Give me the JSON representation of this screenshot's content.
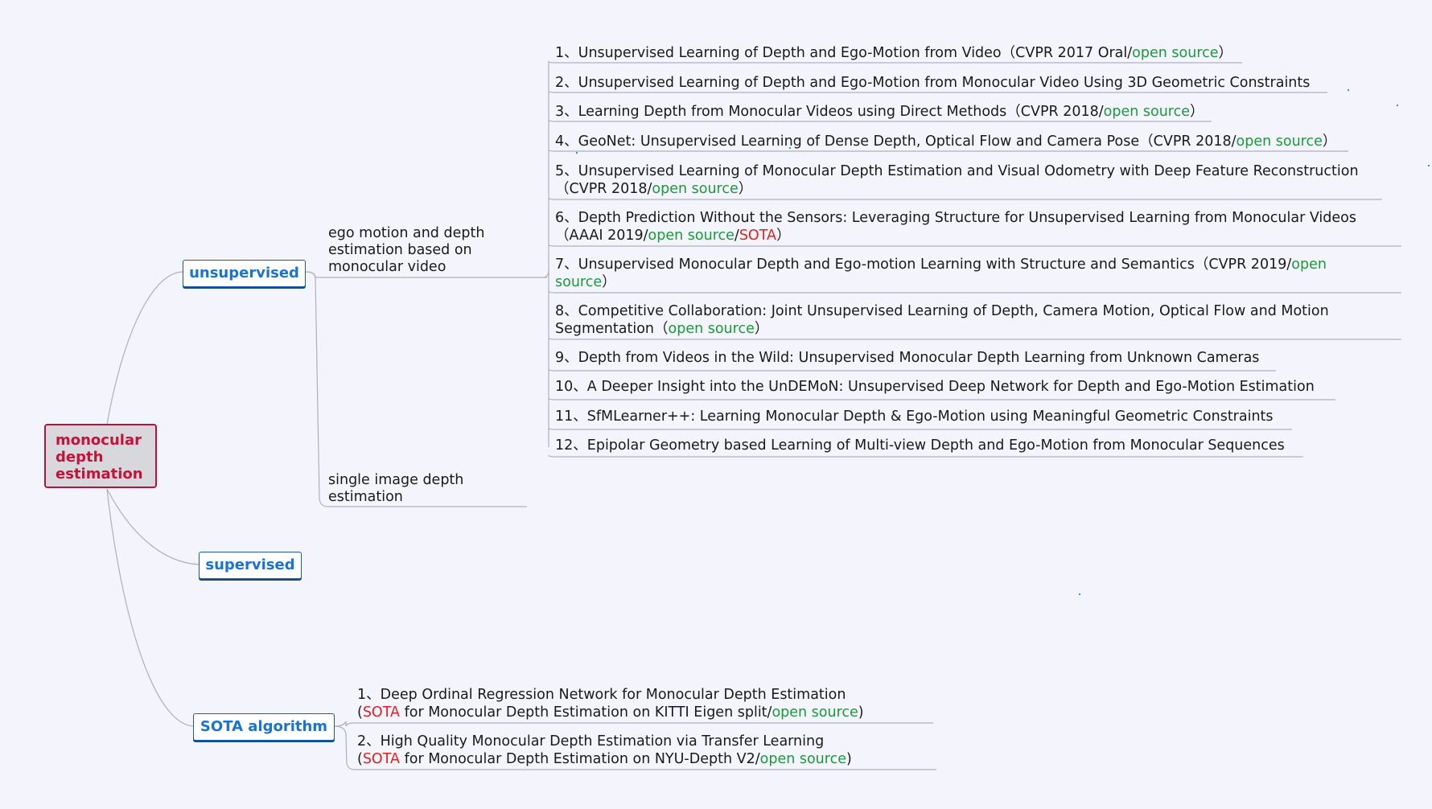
{
  "root": {
    "label": "monocular depth estimation"
  },
  "branches": {
    "unsupervised": {
      "label": "unsupervised",
      "subtopics": {
        "ego": {
          "label": "ego motion and depth estimation based on monocular video"
        },
        "single": {
          "label": "single image depth estimation"
        }
      },
      "papers": [
        {
          "num": "1、",
          "title": "Unsupervised Learning of Depth and Ego-Motion from Video",
          "venue": "（CVPR 2017 Oral/",
          "open": "open source",
          "close": "）"
        },
        {
          "num": "2、",
          "title": "Unsupervised Learning of Depth and Ego-Motion from Monocular Video Using 3D Geometric Constraints"
        },
        {
          "num": "3、",
          "title": "Learning Depth from Monocular Videos using Direct Methods",
          "venue": "（CVPR 2018/",
          "open": "open source",
          "close": "）"
        },
        {
          "num": "4、",
          "title": "GeoNet: Unsupervised Learning of Dense Depth, Optical Flow and Camera Pose",
          "venue": "（CVPR 2018/",
          "open": "open source",
          "close": "）"
        },
        {
          "num": "5、",
          "title": "Unsupervised Learning of Monocular Depth Estimation and Visual Odometry with Deep Feature Reconstruction",
          "venue": "（CVPR 2018/",
          "open": "open source",
          "close": "）"
        },
        {
          "num": "6、",
          "title": "Depth Prediction Without the Sensors: Leveraging Structure for Unsupervised Learning from Monocular Videos",
          "venue": "（AAAI 2019/",
          "open": "open source",
          "sep": "/",
          "sota": "SOTA",
          "close": "）"
        },
        {
          "num": "7、",
          "title": "Unsupervised Monocular Depth and Ego-motion Learning with Structure and Semantics",
          "venue": "（CVPR 2019/",
          "open1": "open",
          "open2": "source",
          "close": "）"
        },
        {
          "num": "8、",
          "title1": "Competitive Collaboration: Joint Unsupervised Learning of Depth, Camera Motion, Optical Flow and Motion",
          "title2": "Segmentation",
          "venue": "（",
          "open": "open source",
          "close": "）"
        },
        {
          "num": "9、",
          "title": "Depth from Videos in the Wild: Unsupervised Monocular Depth Learning from Unknown Cameras"
        },
        {
          "num": "10、",
          "title": "A Deeper Insight into the UnDEMoN: Unsupervised Deep Network for Depth and Ego-Motion Estimation"
        },
        {
          "num": "11、",
          "title": "SfMLearner++: Learning Monocular Depth & Ego-Motion using Meaningful Geometric Constraints"
        },
        {
          "num": "12、",
          "title": "Epipolar Geometry based Learning of Multi-view Depth and Ego-Motion from Monocular Sequences"
        }
      ]
    },
    "supervised": {
      "label": "supervised"
    },
    "sota": {
      "label": "SOTA algorithm",
      "papers": [
        {
          "num": "1、",
          "title": "Deep Ordinal Regression Network for Monocular Depth Estimation",
          "pre": "(",
          "sota": "SOTA",
          "desc": " for Monocular Depth Estimation on KITTI Eigen split/",
          "open": "open source",
          "post": ")"
        },
        {
          "num": "2、",
          "title": "High Quality Monocular Depth Estimation via Transfer Learning",
          "pre": "(",
          "sota": "SOTA",
          "desc": " for Monocular Depth Estimation on NYU-Depth V2/",
          "open": "open source",
          "post": ")"
        }
      ]
    }
  },
  "colors": {
    "background": "#f3f4fc",
    "root_fill": "#d8d8dc",
    "root_border": "#b3143a",
    "root_text": "#c4123a",
    "category_text": "#1a73d1",
    "open_source": "#1a9a3a",
    "sota": "#e02020",
    "connector": "#b8b8c4"
  }
}
